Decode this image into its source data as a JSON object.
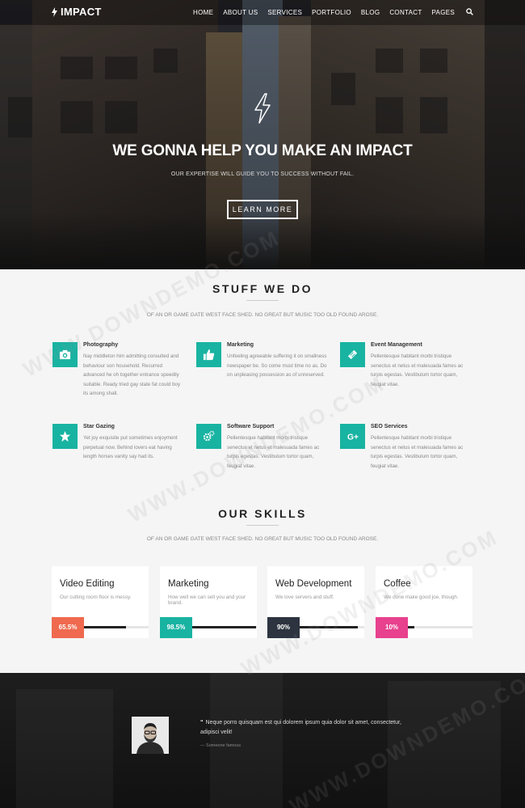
{
  "brand": {
    "name": "IMPACT"
  },
  "nav": {
    "items": [
      "HOME",
      "ABOUT US",
      "SERVICES",
      "PORTFOLIO",
      "BLOG",
      "CONTACT",
      "PAGES"
    ]
  },
  "hero": {
    "title": "WE GONNA HELP YOU MAKE AN IMPACT",
    "subtitle": "OUR EXPERTISE WILL GUIDE YOU TO SUCCESS WITHOUT FAIL.",
    "button": "LEARN MORE"
  },
  "services": {
    "title": "STUFF WE DO",
    "subtitle": "OF AN OR GAME GATE WEST FACE SHED. NO GREAT BUT MUSIC TOO OLD FOUND AROSE.",
    "items": [
      {
        "name": "Photography",
        "icon": "camera-icon",
        "desc": "Nay middleton him admitting consulted and behaviour son household. Recurred advanced he oh together entrance speedily suitable. Ready tried gay state fat could boy its among shall."
      },
      {
        "name": "Marketing",
        "icon": "thumbs-up-icon",
        "desc": "Unfeeling agreeable suffering it on smallness newspaper be. So come must time no as. Do on unpleasing possession as of unreserved."
      },
      {
        "name": "Event Management",
        "icon": "ticket-icon",
        "desc": "Pellentesque habitant morbi tristique senectus et netus et malesuada fames ac turpis egestas. Vestibulum tortor quam, feugiat vitae."
      },
      {
        "name": "Star Gazing",
        "icon": "star-icon",
        "desc": "Yet joy exquisite put sometimes enjoyment perpetual now. Behind lovers eat having length horses vanity say had its."
      },
      {
        "name": "Software Support",
        "icon": "gears-icon",
        "desc": "Pellentesque habitant morbi tristique senectus et netus et malesuada fames ac turpis egestas. Vestibulum tortor quam, feugiat vitae."
      },
      {
        "name": "SEO Services",
        "icon": "google-plus-icon",
        "desc": "Pellentesque habitant morbi tristique senectus et netus et malesuada fames ac turpis egestas. Vestibulum tortor quam, feugiat vitae."
      }
    ]
  },
  "skills": {
    "title": "OUR SKILLS",
    "subtitle": "OF AN OR GAME GATE WEST FACE SHED. NO GREAT BUT MUSIC TOO OLD FOUND AROSE.",
    "items": [
      {
        "name": "Video Editing",
        "desc": "Our cutting room floor is messy.",
        "label": "65.5%",
        "value": 65.5,
        "color": "#ef6a4f"
      },
      {
        "name": "Marketing",
        "desc": "How well we can sell you and your brand.",
        "label": "98.5%",
        "value": 98.5,
        "color": "#19b3a2"
      },
      {
        "name": "Web Development",
        "desc": "We love servers and stuff.",
        "label": "90%",
        "value": 90,
        "color": "#2d3440"
      },
      {
        "name": "Coffee",
        "desc": "We done make good joe, though.",
        "label": "10%",
        "value": 10,
        "color": "#e8418e"
      }
    ]
  },
  "testimonial": {
    "quote": "Neque porro quisquam est qui dolorem ipsum quia dolor sit amet, consectetur, adipisci velit!",
    "author": "— Someone famous"
  },
  "watermark": "WWW.DOWNDEMO.COM",
  "colors": {
    "accent": "#19b3a2"
  }
}
